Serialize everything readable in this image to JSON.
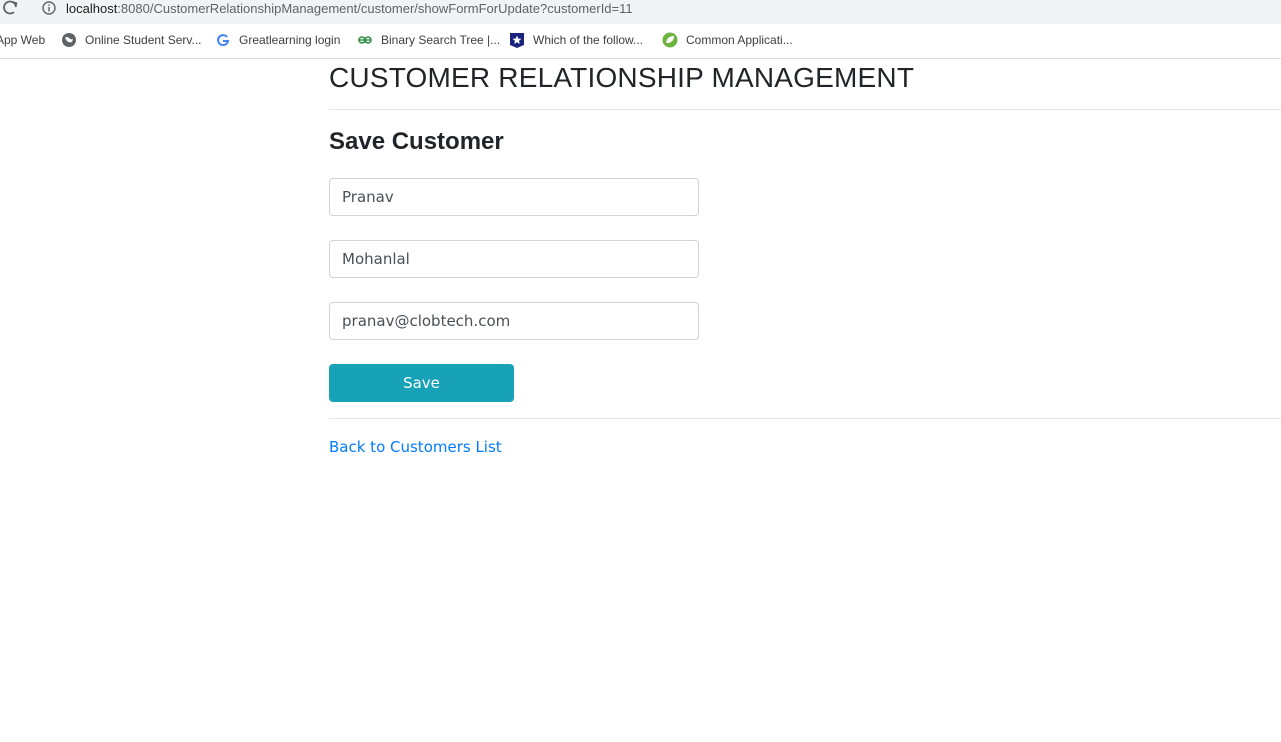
{
  "browser": {
    "url_host": "localhost",
    "url_rest": ":8080/CustomerRelationshipManagement/customer/showFormForUpdate?customerId=11",
    "bookmarks": [
      {
        "label": "App Web",
        "icon": "none"
      },
      {
        "label": "Online Student Serv...",
        "icon": "globe-icon"
      },
      {
        "label": "Greatlearning login",
        "icon": "google-icon"
      },
      {
        "label": "Binary Search Tree |...",
        "icon": "gfg-icon"
      },
      {
        "label": "Which of the follow...",
        "icon": "star-badge-icon"
      },
      {
        "label": "Common Applicati...",
        "icon": "leaf-icon"
      }
    ]
  },
  "page": {
    "title": "CUSTOMER RELATIONSHIP MANAGEMENT",
    "form_heading": "Save Customer",
    "first_name": "Pranav",
    "last_name": "Mohanlal",
    "email": "pranav@clobtech.com",
    "save_label": "Save",
    "back_link": "Back to Customers List"
  },
  "colors": {
    "save_button": "#17a2b8",
    "link": "#007bff"
  }
}
